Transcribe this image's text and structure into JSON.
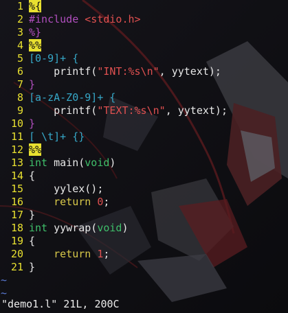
{
  "colors": {
    "linenr": "#e8e030",
    "text": "#e8e8e8",
    "preproc": "#b14fbf",
    "string": "#e05050",
    "number": "#e05050",
    "type": "#3fbf6a",
    "keyword": "#d9c94a",
    "regex": "#36a8c8",
    "tilde": "#5b7bd6"
  },
  "editor": {
    "lines": [
      {
        "n": "1",
        "tokens": [
          {
            "t": "%{",
            "c": "cursor"
          }
        ]
      },
      {
        "n": "2",
        "tokens": [
          {
            "t": "#include ",
            "c": "preproc"
          },
          {
            "t": "<stdio.h>",
            "c": "string"
          }
        ]
      },
      {
        "n": "3",
        "tokens": [
          {
            "t": "%}",
            "c": "preproc"
          }
        ]
      },
      {
        "n": "4",
        "tokens": [
          {
            "t": "%%",
            "c": "hl-y"
          }
        ]
      },
      {
        "n": "5",
        "tokens": [
          {
            "t": "[0-9]+ {",
            "c": "regex"
          }
        ]
      },
      {
        "n": "6",
        "tokens": [
          {
            "t": "    printf(",
            "c": "text"
          },
          {
            "t": "\"INT:%s\\n\"",
            "c": "string"
          },
          {
            "t": ", yytext);",
            "c": "text"
          }
        ]
      },
      {
        "n": "7",
        "tokens": [
          {
            "t": "}",
            "c": "preproc"
          }
        ]
      },
      {
        "n": "8",
        "tokens": [
          {
            "t": "[a-zA-Z0-9]+ {",
            "c": "regex"
          }
        ]
      },
      {
        "n": "9",
        "tokens": [
          {
            "t": "    printf(",
            "c": "text"
          },
          {
            "t": "\"TEXT:%s\\n\"",
            "c": "string"
          },
          {
            "t": ", yytext);",
            "c": "text"
          }
        ]
      },
      {
        "n": "10",
        "tokens": [
          {
            "t": "}",
            "c": "preproc"
          }
        ]
      },
      {
        "n": "11",
        "tokens": [
          {
            "t": "[ \\t]+ {}",
            "c": "regex"
          }
        ]
      },
      {
        "n": "12",
        "tokens": [
          {
            "t": "%%",
            "c": "hl-y"
          }
        ]
      },
      {
        "n": "13",
        "tokens": [
          {
            "t": "int",
            "c": "type"
          },
          {
            "t": " main(",
            "c": "text"
          },
          {
            "t": "void",
            "c": "type"
          },
          {
            "t": ")",
            "c": "text"
          }
        ]
      },
      {
        "n": "14",
        "tokens": [
          {
            "t": "{",
            "c": "text"
          }
        ]
      },
      {
        "n": "15",
        "tokens": [
          {
            "t": "    yylex();",
            "c": "text"
          }
        ]
      },
      {
        "n": "16",
        "tokens": [
          {
            "t": "    ",
            "c": "text"
          },
          {
            "t": "return",
            "c": "keyword"
          },
          {
            "t": " ",
            "c": "text"
          },
          {
            "t": "0",
            "c": "number"
          },
          {
            "t": ";",
            "c": "text"
          }
        ]
      },
      {
        "n": "17",
        "tokens": [
          {
            "t": "}",
            "c": "text"
          }
        ]
      },
      {
        "n": "18",
        "tokens": [
          {
            "t": "int",
            "c": "type"
          },
          {
            "t": " yywrap(",
            "c": "text"
          },
          {
            "t": "void",
            "c": "type"
          },
          {
            "t": ")",
            "c": "text"
          }
        ]
      },
      {
        "n": "19",
        "tokens": [
          {
            "t": "{",
            "c": "text"
          }
        ]
      },
      {
        "n": "20",
        "tokens": [
          {
            "t": "    ",
            "c": "text"
          },
          {
            "t": "return",
            "c": "keyword"
          },
          {
            "t": " ",
            "c": "text"
          },
          {
            "t": "1",
            "c": "number"
          },
          {
            "t": ";",
            "c": "text"
          }
        ]
      },
      {
        "n": "21",
        "tokens": [
          {
            "t": "}",
            "c": "text"
          }
        ]
      }
    ],
    "tildes": [
      "~",
      "~"
    ]
  },
  "status_line": "\"demo1.l\" 21L, 200C"
}
